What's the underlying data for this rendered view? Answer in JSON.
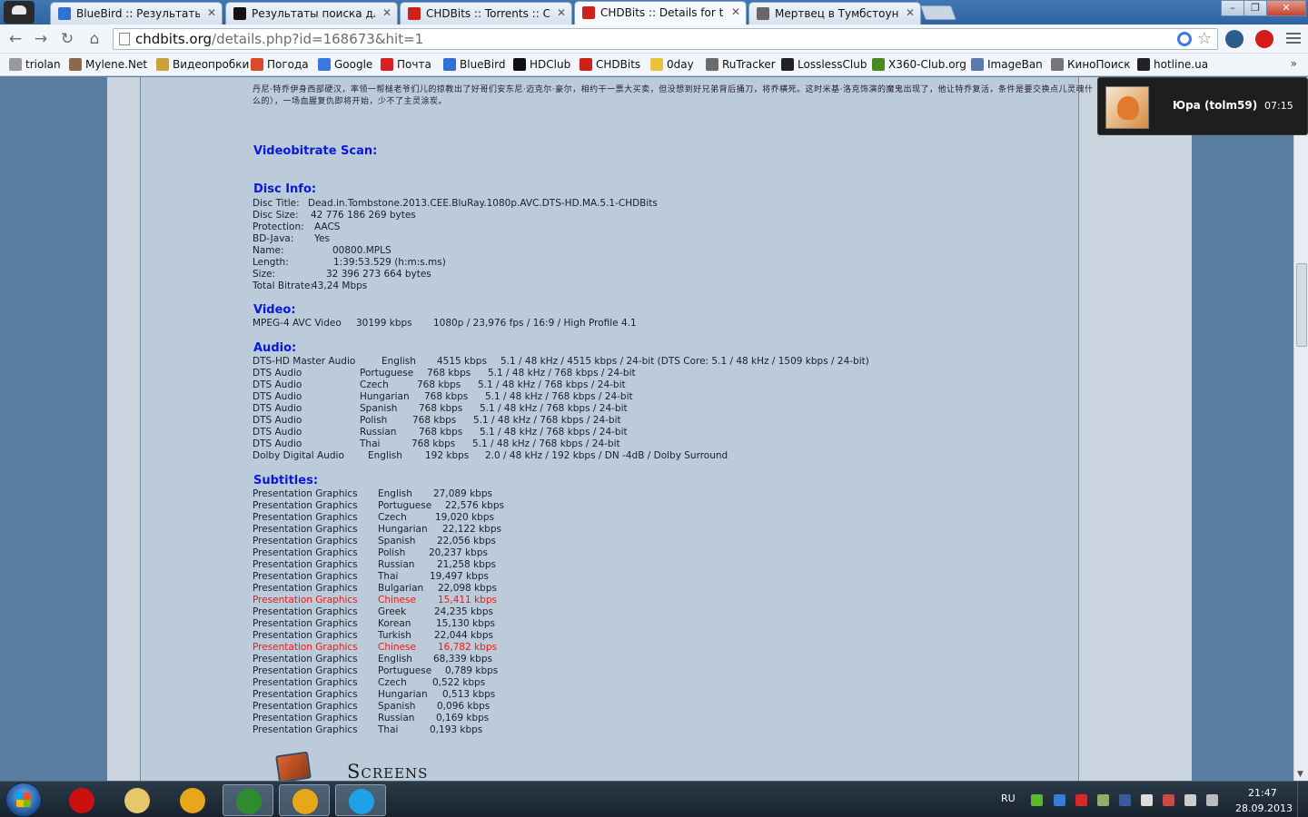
{
  "tabs": [
    {
      "title": "BlueBird :: Результаты по",
      "favicon": "bluebird-icon",
      "color": "#2f6fd6"
    },
    {
      "title": "Результаты поиска для \"",
      "favicon": "hd-icon",
      "color": "#111111"
    },
    {
      "title": "CHDBits :: Torrents :: CHD",
      "favicon": "chd-icon",
      "color": "#d0201c"
    },
    {
      "title": "CHDBits :: Details for torre",
      "favicon": "chd-icon",
      "color": "#d0201c"
    },
    {
      "title": "Мертвец в Тумбстоуне",
      "favicon": "film-icon",
      "color": "#666666"
    }
  ],
  "address": {
    "host": "chdbits.org",
    "path": "/details.php?id=168673&hit=1"
  },
  "bookmarks": [
    {
      "label": "triolan",
      "icon": "page-icon",
      "color": "#999999"
    },
    {
      "label": "Mylene.Net",
      "icon": "photo-icon",
      "color": "#8a6a4a"
    },
    {
      "label": "Видеопробки",
      "icon": "road-icon",
      "color": "#c9a23a"
    },
    {
      "label": "Погода",
      "icon": "weather-icon",
      "color": "#d84a2a"
    },
    {
      "label": "Google",
      "icon": "google-icon",
      "color": "#3a78e0"
    },
    {
      "label": "Почта",
      "icon": "mail-icon",
      "color": "#d92020"
    },
    {
      "label": "BlueBird",
      "icon": "bluebird-icon",
      "color": "#2f6fd6"
    },
    {
      "label": "HDClub",
      "icon": "hd-icon",
      "color": "#111111"
    },
    {
      "label": "CHDBits",
      "icon": "chd-icon",
      "color": "#d0201c"
    },
    {
      "label": "0day",
      "icon": "ukraine-flag-icon",
      "color": "#e8c23a"
    },
    {
      "label": "RuTracker",
      "icon": "rutracker-icon",
      "color": "#6a6a6a"
    },
    {
      "label": "LosslessClub",
      "icon": "lossless-icon",
      "color": "#222222"
    },
    {
      "label": "X360-Club.org",
      "icon": "xbox-icon",
      "color": "#4a8a1a"
    },
    {
      "label": "ImageBan",
      "icon": "image-icon",
      "color": "#5a7ab0"
    },
    {
      "label": "КиноПоиск",
      "icon": "film-icon",
      "color": "#777777"
    },
    {
      "label": "hotline.ua",
      "icon": "hotline-icon",
      "color": "#222222"
    }
  ],
  "description_text": "丹尼·特乔伊身西部硬汉，率领一帮槌老爷们儿的掠教出了好哥们安东尼·迈克尔·豪尔，相约干一票大买卖，但没想到好兄弟背后捅刀，将乔横死。这时米基·洛克饰演的魔鬼出现了，他让特乔复活，条件是要交换点儿灵魂什么的），一场血腥复仇即将开始，少不了主灵涂炭。",
  "sections": {
    "videobitrate": "Videobitrate Scan:",
    "disc_info": "Disc Info:",
    "video": "Video:",
    "audio": "Audio:",
    "subtitles": "Subtitles:"
  },
  "disc_info": [
    {
      "label": "Disc Title:",
      "value": "Dead.in.Tombstone.2013.CEE.BluRay.1080p.AVC.DTS-HD.MA.5.1-CHDBits"
    },
    {
      "label": "Disc Size:",
      "value": "42 776 186 269 bytes"
    },
    {
      "label": "Protection:",
      "value": "AACS"
    },
    {
      "label": "BD-Java:",
      "value": "Yes"
    },
    {
      "label": "Name:",
      "value": "00800.MPLS"
    },
    {
      "label": "Length:",
      "value": "1:39:53.529 (h:m:s.ms)"
    },
    {
      "label": "Size:",
      "value": "32 396 273 664 bytes"
    },
    {
      "label": "Total Bitrate:",
      "value": "43,24 Mbps"
    }
  ],
  "video": [
    {
      "codec": "MPEG-4 AVC Video",
      "bitrate": "30199 kbps",
      "desc": "1080p / 23,976 fps / 16:9 / High Profile 4.1"
    }
  ],
  "audio": [
    {
      "codec": "DTS-HD Master Audio",
      "lang": "English",
      "bitrate": "4515 kbps",
      "desc": "5.1 / 48 kHz / 4515 kbps / 24-bit (DTS Core: 5.1 / 48 kHz / 1509 kbps / 24-bit)"
    },
    {
      "codec": "DTS Audio",
      "lang": "Portuguese",
      "bitrate": "768 kbps",
      "desc": "5.1 / 48 kHz / 768 kbps / 24-bit"
    },
    {
      "codec": "DTS Audio",
      "lang": "Czech",
      "bitrate": "768 kbps",
      "desc": "5.1 / 48 kHz / 768 kbps / 24-bit"
    },
    {
      "codec": "DTS Audio",
      "lang": "Hungarian",
      "bitrate": "768 kbps",
      "desc": "5.1 / 48 kHz / 768 kbps / 24-bit"
    },
    {
      "codec": "DTS Audio",
      "lang": "Spanish",
      "bitrate": "768 kbps",
      "desc": "5.1 / 48 kHz / 768 kbps / 24-bit"
    },
    {
      "codec": "DTS Audio",
      "lang": "Polish",
      "bitrate": "768 kbps",
      "desc": "5.1 / 48 kHz / 768 kbps / 24-bit"
    },
    {
      "codec": "DTS Audio",
      "lang": "Russian",
      "bitrate": "768 kbps",
      "desc": "5.1 / 48 kHz / 768 kbps / 24-bit"
    },
    {
      "codec": "DTS Audio",
      "lang": "Thai",
      "bitrate": "768 kbps",
      "desc": "5.1 / 48 kHz / 768 kbps / 24-bit"
    },
    {
      "codec": "Dolby Digital Audio",
      "lang": "English",
      "bitrate": "192 kbps",
      "desc": "2.0 / 48 kHz / 192 kbps / DN -4dB / Dolby Surround"
    }
  ],
  "subtitles": [
    {
      "codec": "Presentation Graphics",
      "lang": "English",
      "bitrate": "27,089 kbps",
      "highlight": false
    },
    {
      "codec": "Presentation Graphics",
      "lang": "Portuguese",
      "bitrate": "22,576 kbps",
      "highlight": false
    },
    {
      "codec": "Presentation Graphics",
      "lang": "Czech",
      "bitrate": "19,020 kbps",
      "highlight": false
    },
    {
      "codec": "Presentation Graphics",
      "lang": "Hungarian",
      "bitrate": "22,122 kbps",
      "highlight": false
    },
    {
      "codec": "Presentation Graphics",
      "lang": "Spanish",
      "bitrate": "22,056 kbps",
      "highlight": false
    },
    {
      "codec": "Presentation Graphics",
      "lang": "Polish",
      "bitrate": "20,237 kbps",
      "highlight": false
    },
    {
      "codec": "Presentation Graphics",
      "lang": "Russian",
      "bitrate": "21,258 kbps",
      "highlight": false
    },
    {
      "codec": "Presentation Graphics",
      "lang": "Thai",
      "bitrate": "19,497 kbps",
      "highlight": false
    },
    {
      "codec": "Presentation Graphics",
      "lang": "Bulgarian",
      "bitrate": "22,098 kbps",
      "highlight": false
    },
    {
      "codec": "Presentation Graphics",
      "lang": "Chinese",
      "bitrate": "15,411 kbps",
      "highlight": true
    },
    {
      "codec": "Presentation Graphics",
      "lang": "Greek",
      "bitrate": "24,235 kbps",
      "highlight": false
    },
    {
      "codec": "Presentation Graphics",
      "lang": "Korean",
      "bitrate": "15,130 kbps",
      "highlight": false
    },
    {
      "codec": "Presentation Graphics",
      "lang": "Turkish",
      "bitrate": "22,044 kbps",
      "highlight": false
    },
    {
      "codec": "Presentation Graphics",
      "lang": "Chinese",
      "bitrate": "16,782 kbps",
      "highlight": true
    },
    {
      "codec": "Presentation Graphics",
      "lang": "English",
      "bitrate": "68,339 kbps",
      "highlight": false
    },
    {
      "codec": "Presentation Graphics",
      "lang": "Portuguese",
      "bitrate": "0,789 kbps",
      "highlight": false
    },
    {
      "codec": "Presentation Graphics",
      "lang": "Czech",
      "bitrate": "0,522 kbps",
      "highlight": false
    },
    {
      "codec": "Presentation Graphics",
      "lang": "Hungarian",
      "bitrate": "0,513 kbps",
      "highlight": false
    },
    {
      "codec": "Presentation Graphics",
      "lang": "Spanish",
      "bitrate": "0,096 kbps",
      "highlight": false
    },
    {
      "codec": "Presentation Graphics",
      "lang": "Russian",
      "bitrate": "0,169 kbps",
      "highlight": false
    },
    {
      "codec": "Presentation Graphics",
      "lang": "Thai",
      "bitrate": "0,193 kbps",
      "highlight": false
    }
  ],
  "screens_heading": "Screens",
  "notification": {
    "name": "Юра (tolm59)",
    "time": "07:15"
  },
  "taskbar": {
    "apps": [
      {
        "name": "opera",
        "color": "#cc1010"
      },
      {
        "name": "explorer",
        "color": "#e8c66a"
      },
      {
        "name": "chrome",
        "color": "#e6a81a"
      },
      {
        "name": "utorrent",
        "color": "#2e8b2e"
      },
      {
        "name": "chrome",
        "color": "#e6a81a"
      },
      {
        "name": "skype",
        "color": "#1ea1e6"
      }
    ],
    "lang": "RU",
    "time": "21:47",
    "date": "28.09.2013"
  },
  "colors": {
    "heading": "#0b18d8",
    "highlight": "#f01818",
    "page_bg": "#5a7ea1"
  }
}
